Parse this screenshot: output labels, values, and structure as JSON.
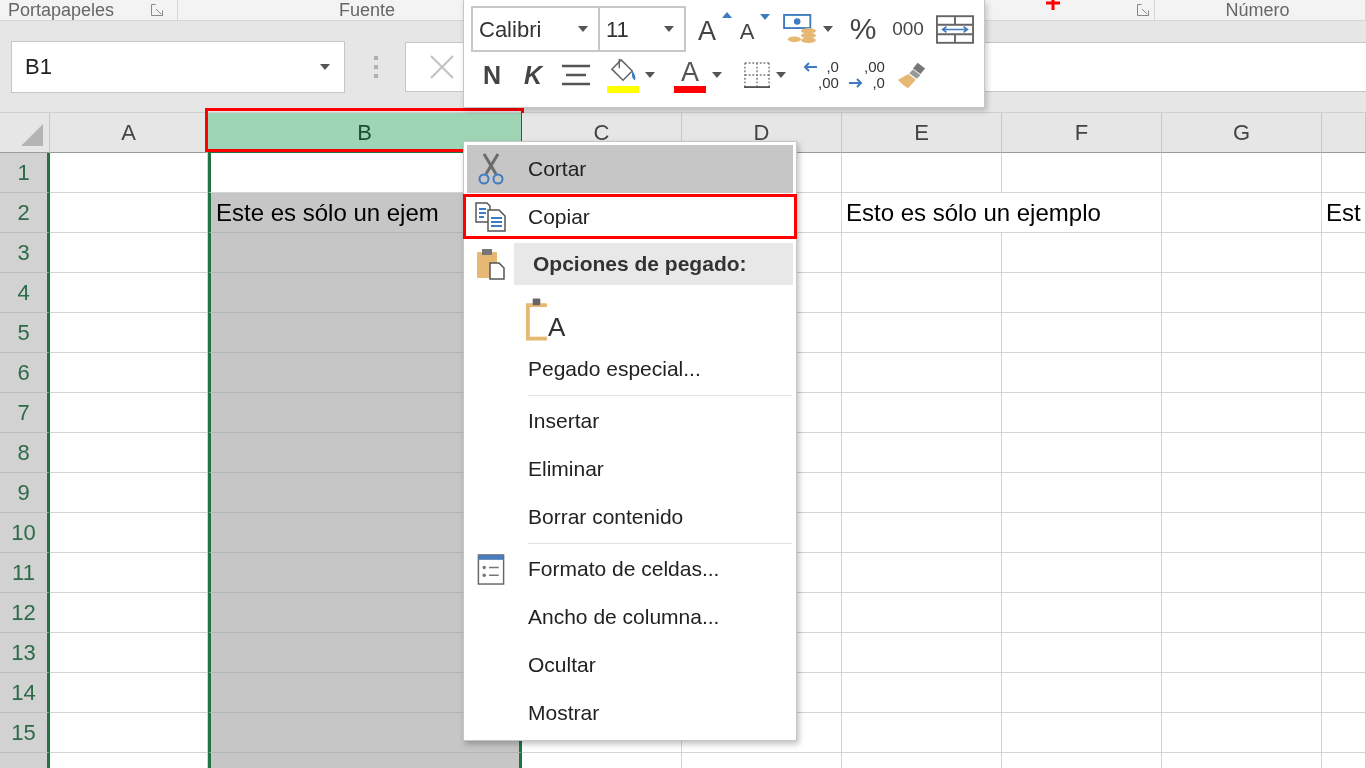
{
  "ribbon": {
    "groups": [
      {
        "label": "Portapapeles",
        "launcher": true
      },
      {
        "label": "Fuente",
        "launcher": false
      },
      {
        "launcher": true
      },
      {
        "label": "Número",
        "launcher": false
      }
    ]
  },
  "formula_bar": {
    "name_box": "B1"
  },
  "mini_toolbar": {
    "font": "Calibri",
    "size": "11",
    "row_1": [
      {
        "kind": "grow",
        "glyph": "A"
      },
      {
        "kind": "shrink",
        "glyph": "A"
      },
      {
        "kind": "accounting",
        "dropdown": true
      },
      {
        "kind": "percent",
        "glyph": "%"
      },
      {
        "kind": "thousands",
        "glyph": "000"
      },
      {
        "kind": "width"
      }
    ],
    "row_2": [
      {
        "kind": "bold",
        "glyph": "N"
      },
      {
        "kind": "italic",
        "glyph": "K"
      },
      {
        "kind": "center"
      },
      {
        "kind": "fill",
        "dropdown": true,
        "color": "#ffff00"
      },
      {
        "kind": "fontcolor",
        "glyph": "A",
        "dropdown": true,
        "color": "#ff0000"
      },
      {
        "kind": "borders",
        "dropdown": true
      },
      {
        "kind": "moredecimals",
        "lines": [
          ",0",
          ",00"
        ]
      },
      {
        "kind": "fewerdecimals",
        "lines": [
          ",00",
          ",0"
        ]
      },
      {
        "kind": "painter"
      }
    ]
  },
  "sheet": {
    "columns": [
      {
        "label": "A",
        "selected": false,
        "annotated": false
      },
      {
        "label": "B",
        "selected": true,
        "annotated": true
      },
      {
        "label": "C",
        "selected": false,
        "annotated": false
      },
      {
        "label": "D",
        "selected": false,
        "annotated": false
      },
      {
        "label": "E",
        "selected": false,
        "annotated": false
      },
      {
        "label": "F",
        "selected": false,
        "annotated": false
      },
      {
        "label": "G",
        "selected": false,
        "annotated": false
      },
      {
        "selected": false,
        "annotated": false
      }
    ],
    "rows": [
      {
        "label": "1",
        "active": true
      },
      {
        "label": "2",
        "active": false,
        "cells": [
          null,
          "Este es sólo un ejem",
          null,
          null,
          "Esto es sólo un ejemplo",
          null,
          null,
          "Est"
        ]
      },
      {
        "label": "3",
        "active": false
      },
      {
        "label": "4",
        "active": false
      },
      {
        "label": "5",
        "active": false
      },
      {
        "label": "6",
        "active": false
      },
      {
        "label": "7",
        "active": false
      },
      {
        "label": "8",
        "active": false
      },
      {
        "label": "9",
        "active": false
      },
      {
        "label": "10",
        "active": false
      },
      {
        "label": "11",
        "active": false
      },
      {
        "label": "12",
        "active": false
      },
      {
        "label": "13",
        "active": false
      },
      {
        "label": "14",
        "active": false
      },
      {
        "label": "15",
        "active": false
      }
    ]
  },
  "context_menu": {
    "items": [
      {
        "kind": "cut",
        "label": "Cortar",
        "hovered": true,
        "annotated": false
      },
      {
        "kind": "copy",
        "label": "Copiar",
        "hovered": false,
        "annotated": true
      },
      {
        "kind": "heading",
        "label": "Opciones de pegado:",
        "hovered": false,
        "annotated": false
      },
      {
        "kind": "paste",
        "glyph": "A",
        "hovered": false,
        "annotated": false
      },
      {
        "kind": "command",
        "label": "Pegado especial...",
        "hovered": false,
        "annotated": false
      },
      {
        "kind": "separator"
      },
      {
        "kind": "command",
        "label": "Insertar",
        "hovered": false,
        "annotated": false
      },
      {
        "kind": "command",
        "label": "Eliminar",
        "hovered": false,
        "annotated": false
      },
      {
        "kind": "command",
        "label": "Borrar contenido",
        "hovered": false,
        "annotated": false
      },
      {
        "kind": "separator"
      },
      {
        "kind": "format",
        "label": "Formato de celdas...",
        "hovered": false,
        "annotated": false
      },
      {
        "kind": "command",
        "label": "Ancho de columna...",
        "hovered": false,
        "annotated": false
      },
      {
        "kind": "command",
        "label": "Ocultar",
        "hovered": false,
        "annotated": false
      },
      {
        "kind": "command",
        "label": "Mostrar",
        "hovered": false,
        "annotated": false
      }
    ]
  }
}
